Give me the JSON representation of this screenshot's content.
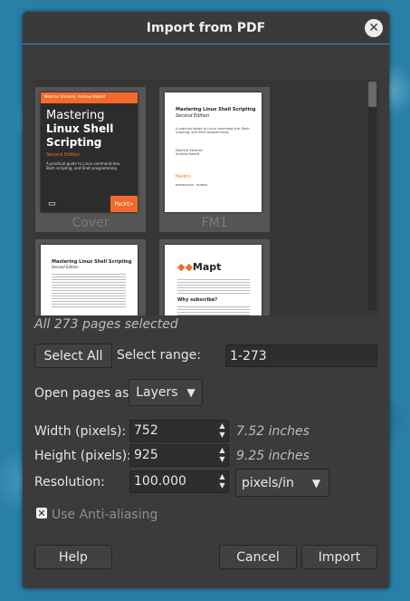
{
  "window": {
    "title": "Import from PDF",
    "close_glyph": "✕"
  },
  "thumbnails": [
    {
      "caption": "Cover",
      "cover_authors": "Mokhtar Ebrahim, Andrew Mallett",
      "cover_title_1": "Mastering",
      "cover_title_2": "Linux Shell",
      "cover_title_3": "Scripting",
      "cover_edition": "Second Edition",
      "cover_sub": "A practical guide to Linux command-line, Bash scripting, and Shell programming",
      "cover_brand": "Packt>"
    },
    {
      "caption": "FM1",
      "fm1_title": "Mastering Linux Shell Scripting",
      "fm1_edition": "Second Edition",
      "fm1_sub": "A practical guide to Linux command-line, Bash scripting, and Shell programming",
      "fm1_authors": "Mokhtar Ebrahim\nAndrew Mallett",
      "fm1_brand": "Packt>",
      "fm1_small": "BIRMINGHAM - MUMBAI"
    },
    {
      "caption": "",
      "p3_title": "Mastering Linux Shell Scripting",
      "p3_edition": "Second Edition"
    },
    {
      "caption": "",
      "p4_brand": "Mapt",
      "p4_heading": "Why subscribe?"
    }
  ],
  "selection_status": "All 273 pages selected",
  "select_all_label": "Select All",
  "select_range_label": "Select range:",
  "select_range_value": "1-273",
  "open_pages_label": "Open pages as",
  "open_pages_value": "Layers",
  "width_label": "Width (pixels):",
  "width_value": "752",
  "width_inches": "7.52 inches",
  "height_label": "Height (pixels):",
  "height_value": "925",
  "height_inches": "9.25 inches",
  "resolution_label": "Resolution:",
  "resolution_value": "100.000",
  "resolution_unit": "pixels/in",
  "antialias_label": "Use Anti-aliasing",
  "antialias_checked": true,
  "buttons": {
    "help": "Help",
    "cancel": "Cancel",
    "import": "Import"
  },
  "colors": {
    "accent": "#2e8dc7",
    "dialog_bg": "#3b3b3b",
    "packt_orange": "#f26a2b"
  }
}
